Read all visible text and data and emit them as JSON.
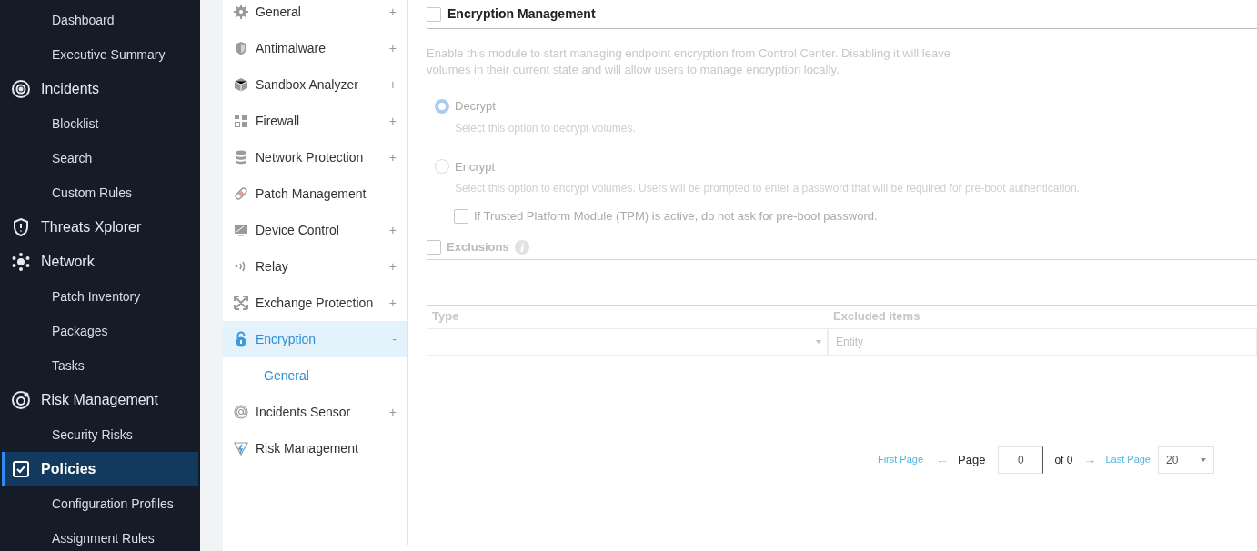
{
  "sidebar": {
    "items": [
      {
        "label": "Dashboard",
        "kind": "sub",
        "selected": false
      },
      {
        "label": "Executive Summary",
        "kind": "sub",
        "selected": false
      },
      {
        "label": "Incidents",
        "kind": "main",
        "selected": false
      },
      {
        "label": "Blocklist",
        "kind": "sub",
        "selected": false
      },
      {
        "label": "Search",
        "kind": "sub",
        "selected": false
      },
      {
        "label": "Custom Rules",
        "kind": "sub",
        "selected": false
      },
      {
        "label": "Threats Xplorer",
        "kind": "main",
        "selected": false
      },
      {
        "label": "Network",
        "kind": "main",
        "selected": false
      },
      {
        "label": "Patch Inventory",
        "kind": "sub",
        "selected": false
      },
      {
        "label": "Packages",
        "kind": "sub",
        "selected": false
      },
      {
        "label": "Tasks",
        "kind": "sub",
        "selected": false
      },
      {
        "label": "Risk Management",
        "kind": "main",
        "selected": false
      },
      {
        "label": "Security Risks",
        "kind": "sub",
        "selected": false
      },
      {
        "label": "Policies",
        "kind": "main",
        "selected": true
      },
      {
        "label": "Configuration Profiles",
        "kind": "sub",
        "selected": false
      },
      {
        "label": "Assignment Rules",
        "kind": "sub",
        "selected": false
      }
    ]
  },
  "modules": {
    "items": [
      {
        "label": "General",
        "toggle": "+",
        "selected": false
      },
      {
        "label": "Antimalware",
        "toggle": "+",
        "selected": false
      },
      {
        "label": "Sandbox Analyzer",
        "toggle": "+",
        "selected": false
      },
      {
        "label": "Firewall",
        "toggle": "+",
        "selected": false
      },
      {
        "label": "Network Protection",
        "toggle": "+",
        "selected": false
      },
      {
        "label": "Patch Management",
        "selected": false
      },
      {
        "label": "Device Control",
        "toggle": "+",
        "selected": false
      },
      {
        "label": "Relay",
        "toggle": "+",
        "selected": false
      },
      {
        "label": "Exchange Protection",
        "toggle": "+",
        "selected": false
      },
      {
        "label": "Encryption",
        "toggle": "-",
        "selected": true,
        "children": [
          {
            "label": "General",
            "selected": false
          }
        ]
      },
      {
        "label": "Incidents Sensor",
        "toggle": "+",
        "selected": false
      },
      {
        "label": "Risk Management",
        "selected": false
      }
    ]
  },
  "encryption": {
    "title": "Encryption Management",
    "checked": false,
    "description": "Enable this module to start managing endpoint encryption from Control Center. Disabling it will leave volumes in their current state and will allow users to manage encryption locally.",
    "options": [
      {
        "label": "Decrypt",
        "hint": "Select this option to decrypt volumes.",
        "selected": true
      },
      {
        "label": "Encrypt",
        "hint": "Select this option to encrypt volumes. Users will be prompted to enter a password that will be required for pre-boot authentication.",
        "selected": false
      }
    ],
    "tpm": {
      "label": "If Trusted Platform Module (TPM) is active, do not ask for pre-boot password.",
      "checked": false
    }
  },
  "exclusions": {
    "title": "Exclusions",
    "checked": false,
    "table": {
      "columns": [
        "Type",
        "Excluded items"
      ],
      "entity_placeholder": "Entity"
    },
    "pagination": {
      "first": "First Page",
      "prev": "←",
      "page_label": "Page",
      "page": "0",
      "of": "of 0",
      "next": "→",
      "last": "Last Page",
      "per_page": "20"
    }
  }
}
